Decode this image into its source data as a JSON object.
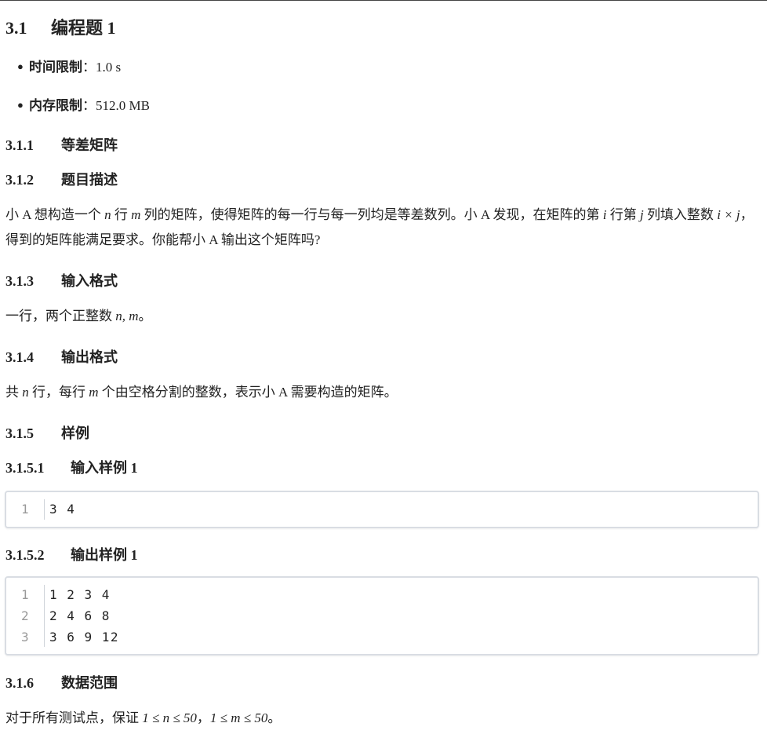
{
  "section": {
    "num": "3.1",
    "title": "编程题 1"
  },
  "meta": [
    {
      "label": "时间限制",
      "sep": "：",
      "value": "1.0 s"
    },
    {
      "label": "内存限制",
      "sep": "：",
      "value": "512.0 MB"
    }
  ],
  "s311": {
    "num": "3.1.1",
    "title": "等差矩阵"
  },
  "s312": {
    "num": "3.1.2",
    "title": "题目描述"
  },
  "desc": {
    "p1": "小 A 想构造一个 ",
    "n1": "n",
    "p2": " 行 ",
    "m1": "m",
    "p3": " 列的矩阵，使得矩阵的每一行与每一列均是等差数列。小 A 发现，在矩阵的第 ",
    "i1": "i",
    "p4": " 行第 ",
    "j1": "j",
    "p5": " 列填入整数 ",
    "expr": "i × j",
    "p6": "，得到的矩阵能满足要求。你能帮小 A 输出这个矩阵吗?"
  },
  "s313": {
    "num": "3.1.3",
    "title": "输入格式"
  },
  "input_fmt": {
    "p1": "一行，两个正整数 ",
    "vars": "n, m",
    "p2": "。"
  },
  "s314": {
    "num": "3.1.4",
    "title": "输出格式"
  },
  "output_fmt": {
    "p1": "共 ",
    "n": "n",
    "p2": " 行，每行 ",
    "m": "m",
    "p3": " 个由空格分割的整数，表示小 A 需要构造的矩阵。"
  },
  "s315": {
    "num": "3.1.5",
    "title": "样例"
  },
  "s3151": {
    "num": "3.1.5.1",
    "title": "输入样例 1"
  },
  "sample_in": [
    {
      "ln": "1",
      "text": "3 4"
    }
  ],
  "s3152": {
    "num": "3.1.5.2",
    "title": "输出样例 1"
  },
  "sample_out": [
    {
      "ln": "1",
      "text": "1 2 3 4"
    },
    {
      "ln": "2",
      "text": "2 4 6 8"
    },
    {
      "ln": "3",
      "text": "3 6 9 12"
    }
  ],
  "s316": {
    "num": "3.1.6",
    "title": "数据范围"
  },
  "range": {
    "p1": "对于所有测试点，保证 ",
    "c1": "1 ≤ n ≤ 50",
    "p2": "，",
    "c2": "1 ≤ m ≤ 50",
    "p3": "。"
  }
}
